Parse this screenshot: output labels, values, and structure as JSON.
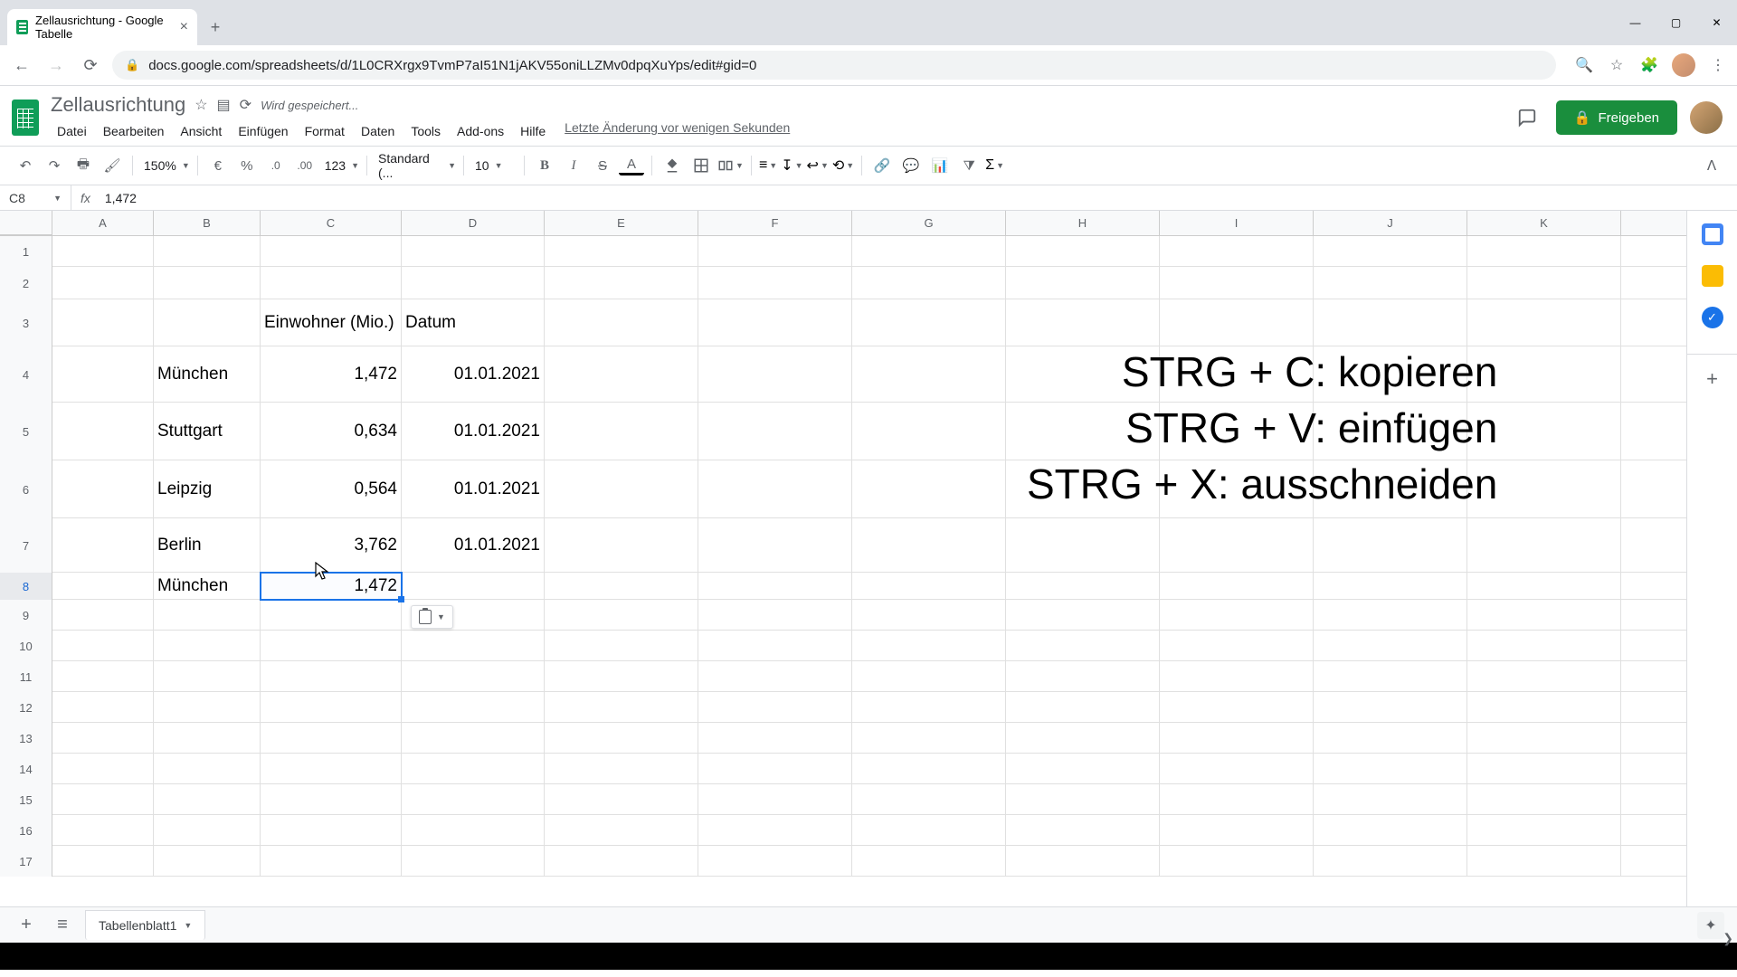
{
  "browser": {
    "tab_title": "Zellausrichtung - Google Tabelle",
    "url": "docs.google.com/spreadsheets/d/1L0CRXrgx9TvmP7aI51N1jAKV55oniLLZMv0dpqXuYps/edit#gid=0"
  },
  "doc": {
    "title": "Zellausrichtung",
    "saving": "Wird gespeichert...",
    "last_edit": "Letzte Änderung vor wenigen Sekunden",
    "share": "Freigeben"
  },
  "menus": [
    "Datei",
    "Bearbeiten",
    "Ansicht",
    "Einfügen",
    "Format",
    "Daten",
    "Tools",
    "Add-ons",
    "Hilfe"
  ],
  "toolbar": {
    "zoom": "150%",
    "currency": "€",
    "percent": "%",
    "dec_dec": ".0",
    "dec_inc": ".00",
    "fmt123": "123",
    "font": "Standard (...",
    "size": "10"
  },
  "namebox": "C8",
  "formula": "1,472",
  "columns": [
    "A",
    "B",
    "C",
    "D",
    "E",
    "F",
    "G",
    "H",
    "I",
    "J",
    "K"
  ],
  "col_widths": [
    "cw-A",
    "cw-B",
    "cw-C",
    "cw-D",
    "cw-E",
    "cw-F",
    "cw-G",
    "cw-H",
    "cw-I",
    "cw-J",
    "cw-K"
  ],
  "row_heights": {
    "1": 34,
    "2": 36,
    "3": 52,
    "4": 62,
    "5": 64,
    "6": 64,
    "7": 60,
    "8": 30,
    "9": 34,
    "10": 34,
    "11": 34,
    "12": 34,
    "13": 34,
    "14": 34,
    "15": 34,
    "16": 34,
    "17": 34
  },
  "cells": {
    "C3": "Einwohner (Mio.)",
    "D3": "Datum",
    "B4": "München",
    "C4": "1,472",
    "D4": "01.01.2021",
    "B5": "Stuttgart",
    "C5": "0,634",
    "D5": "01.01.2021",
    "B6": "Leipzig",
    "C6": "0,564",
    "D6": "01.01.2021",
    "B7": "Berlin",
    "C7": "3,762",
    "D7": "01.01.2021",
    "B8": "München",
    "C8": "1,472"
  },
  "selection": {
    "cell": "C8"
  },
  "sheet_tab": "Tabellenblatt1",
  "overlay": {
    "l1": "STRG + C: kopieren",
    "l2": "STRG + V: einfügen",
    "l3": "STRG + X: ausschneiden"
  }
}
